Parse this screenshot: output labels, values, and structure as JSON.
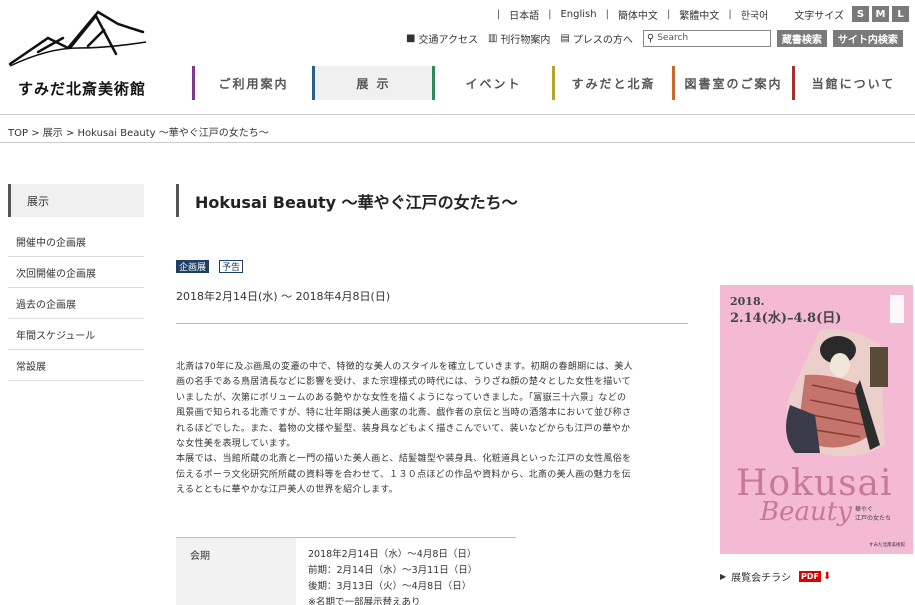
{
  "logo": {
    "text": "すみだ北斎美術館"
  },
  "lang": {
    "items": [
      "日本語",
      "English",
      "簡体中文",
      "繁體中文",
      "한국어"
    ],
    "size_label": "文字サイズ",
    "sizes": [
      "S",
      "M",
      "L"
    ]
  },
  "util": {
    "access": "交通アクセス",
    "publications": "刊行物案内",
    "press": "プレスの方へ",
    "search_placeholder": "Search",
    "collection_search": "蔵書検索",
    "site_search": "サイト内検索"
  },
  "gnav": [
    "ご利用案内",
    "展 示",
    "イベント",
    "すみだと北斎",
    "図書室のご案内",
    "当館について"
  ],
  "gnav_colors": [
    "#7b3a8e",
    "#2b5f8a",
    "#2e8a5c",
    "#b8a32a",
    "#c96a2c",
    "#a8302c"
  ],
  "breadcrumb": "TOP > 展示 > Hokusai Beauty ～華やぐ江戸の女たち～",
  "sidebar": {
    "heading": "展示",
    "items": [
      "開催中の企画展",
      "次回開催の企画展",
      "過去の企画展",
      "年間スケジュール",
      "常設展"
    ]
  },
  "main": {
    "title": "Hokusai Beauty ～華やぐ江戸の女たち～",
    "tag_primary": "企画展",
    "tag_secondary": "予告",
    "date_range": "2018年2月14日(水) ～ 2018年4月8日(日)",
    "desc": [
      "北斎は70年に及ぶ画風の変遷の中で、特徴的な美人のスタイルを確立していきます。初期の春朗期には、美人",
      "画の名手である鳥居清長などに影響を受け、また宗理様式の時代には、うりざね顔の楚々とした女性を描いて",
      "いましたが、次第にボリュームのある艶やかな女性を描くようになっていきました。「冨嶽三十六景」などの",
      "風景画で知られる北斎ですが、特に壮年期は美人画家の北斎、戯作者の京伝と当時の酒落本において並び称さ",
      "れるほどでした。また、着物の文様や髪型、装身具などもよく描きこんでいて、装いなどからも江戸の華やか",
      "な女性美を表現しています。",
      "本展では、当館所蔵の北斎と一門の描いた美人画と、結髪雛型や装身具、化粧道具といった江戸の女性風俗を",
      "伝えるポーラ文化研究所所蔵の資料等を合わせて、１３０点ほどの作品や資料から、北斎の美人画の魅力を伝",
      "えるとともに華やかな江戸美人の世界を紹介します。"
    ],
    "info": {
      "label": "会期",
      "lines": [
        "2018年2月14日（水）～4月8日（日）",
        "前期：2月14日（水）～3月11日（日）",
        "後期：3月13日（火）～4月8日（日）",
        "※名期で一部展示替えあり"
      ]
    }
  },
  "poster": {
    "year": "2018.",
    "dates": "2.14(水)–4.8(日)",
    "title1": "Hokusai",
    "title2": "Beauty",
    "subtitle1": "華やぐ",
    "subtitle2": "江戸の女たち",
    "museum": "すみだ北斎美術館"
  },
  "flyer": {
    "label": "展覧会チラシ",
    "pdf": "PDF"
  }
}
